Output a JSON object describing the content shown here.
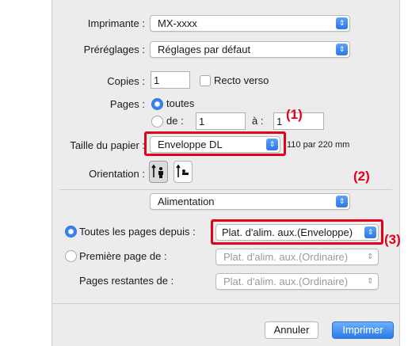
{
  "printer": {
    "label": "Imprimante :",
    "value": "MX-xxxx"
  },
  "presets": {
    "label": "Préréglages :",
    "value": "Réglages par défaut"
  },
  "copies": {
    "label": "Copies :",
    "value": "1",
    "duplex_label": "Recto verso"
  },
  "pages": {
    "label": "Pages :",
    "all_label": "toutes",
    "from_label": "de :",
    "from_value": "1",
    "to_label": "à :",
    "to_value": "1"
  },
  "paper": {
    "label": "Taille du papier :",
    "value": "Enveloppe DL",
    "dimensions": "110 par 220 mm"
  },
  "orientation": {
    "label": "Orientation :",
    "portrait_icon": "portrait-person-icon",
    "landscape_icon": "landscape-person-icon"
  },
  "section_popup": {
    "value": "Alimentation"
  },
  "feed": {
    "all_pages_label": "Toutes les pages depuis :",
    "all_pages_value": "Plat. d'alim. aux.(Enveloppe)",
    "first_page_label": "Première page de :",
    "first_page_value": "Plat. d'alim. aux.(Ordinaire)",
    "remaining_label": "Pages restantes de :",
    "remaining_value": "Plat. d'alim. aux.(Ordinaire)"
  },
  "buttons": {
    "cancel": "Annuler",
    "print": "Imprimer"
  },
  "callouts": {
    "c1": "(1)",
    "c2": "(2)",
    "c3": "(3)"
  },
  "colors": {
    "accent": "#3b82f0",
    "highlight": "#e2001a",
    "panel": "#ececec"
  }
}
